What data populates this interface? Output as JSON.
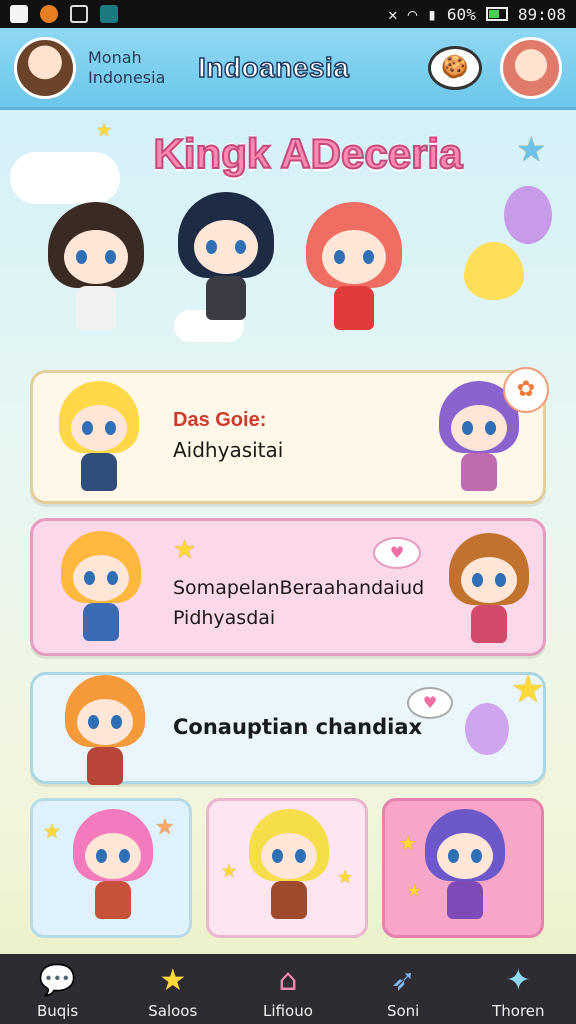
{
  "status_bar": {
    "battery": "60%",
    "time": "89:08",
    "icons": [
      "app-notification-icon",
      "record-icon",
      "gallery-icon",
      "store-icon",
      "mute-icon",
      "wifi-icon",
      "signal-icon",
      "battery-icon"
    ]
  },
  "header": {
    "subtitle": "Monah Indonesia",
    "title": "Indoanesia",
    "chat_icon": "chat-bubble-icon",
    "colors": {
      "bar": "#7fd0ef",
      "title_stroke": "#1f3a60"
    }
  },
  "banner": {
    "title": "Kingk ADeceria",
    "colors": {
      "title_fill": "#ff8ab0",
      "title_stroke": "#c24a7e"
    }
  },
  "cards": [
    {
      "heading": "Das Goie:",
      "body": "Aidhyasitai"
    },
    {
      "heading": "",
      "body_line1": "SomapelanBeraahandaiud",
      "body_line2": "Pidhyasdai"
    },
    {
      "heading": "",
      "body": "Conauptian chandiax"
    }
  ],
  "bottom_nav": {
    "items": [
      {
        "label": "Buqis",
        "icon": "chat-bubble-icon"
      },
      {
        "label": "Saloos",
        "icon": "star-icon"
      },
      {
        "label": "Lifiouo",
        "icon": "home-icon"
      },
      {
        "label": "Soni",
        "icon": "rocket-icon"
      },
      {
        "label": "Thoren",
        "icon": "sparkle-icon"
      }
    ]
  }
}
